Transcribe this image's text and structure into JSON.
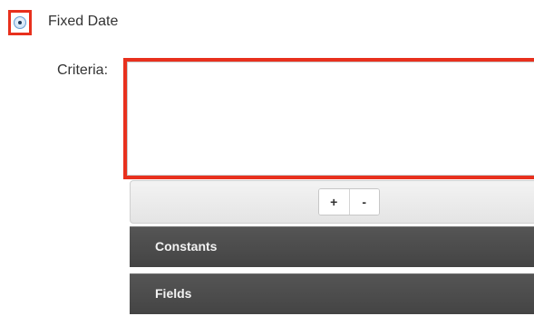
{
  "date_option": {
    "label": "Fixed Date",
    "selected": true
  },
  "criteria": {
    "label": "Criteria:",
    "value": ""
  },
  "toolbar": {
    "add_label": "+",
    "remove_label": "-"
  },
  "sections": [
    {
      "title": "Constants"
    },
    {
      "title": "Fields"
    }
  ],
  "colors": {
    "highlight": "#e8301d",
    "section_bg": "#4a4a4a"
  },
  "icons": {
    "radio": "radio-selected-icon"
  }
}
